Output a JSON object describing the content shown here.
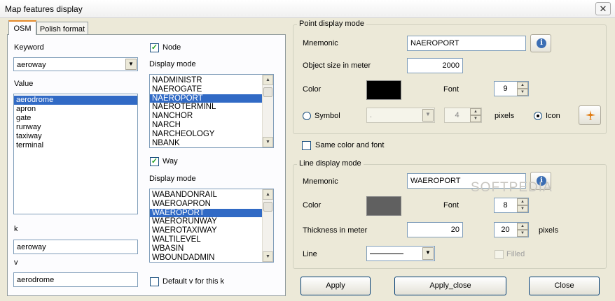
{
  "window": {
    "title": "Map features display",
    "close_glyph": "✕"
  },
  "tabs": [
    {
      "label": "OSM"
    },
    {
      "label": "Polish format"
    }
  ],
  "osm": {
    "keyword_label": "Keyword",
    "keyword_value": "aeroway",
    "value_label": "Value",
    "values": [
      "aerodrome",
      "apron",
      "gate",
      "runway",
      "taxiway",
      "terminal"
    ],
    "selected_value": "aerodrome",
    "k_label": "k",
    "k_value": "aeroway",
    "v_label": "v",
    "v_value": "aerodrome"
  },
  "polish": {
    "node_label": "Node",
    "node_display_mode_label": "Display mode",
    "node_modes": [
      "NADMINISTR",
      "NAEROGATE",
      "NAEROPORT",
      "NAEROTERMINL",
      "NANCHOR",
      "NARCH",
      "NARCHEOLOGY",
      "NBANK"
    ],
    "node_selected": "NAEROPORT",
    "way_label": "Way",
    "way_display_mode_label": "Display mode",
    "way_modes": [
      "WABANDONRAIL",
      "WAEROAPRON",
      "WAEROPORT",
      "WAERORUNWAY",
      "WAEROTAXIWAY",
      "WALTILEVEL",
      "WBASIN",
      "WBOUNDADMIN"
    ],
    "way_selected": "WAEROPORT",
    "default_v_label": "Default v for this k"
  },
  "point_display": {
    "legend": "Point display mode",
    "mnemonic_label": "Mnemonic",
    "mnemonic_value": "NAEROPORT",
    "object_size_label": "Object size in meter",
    "object_size_value": "2000",
    "color_label": "Color",
    "color_value": "#000000",
    "font_label": "Font",
    "font_value": "9",
    "symbol_label": "Symbol",
    "symbol_value": ".",
    "symbol_size_value": "4",
    "pixels_label": "pixels",
    "icon_label": "Icon"
  },
  "same_color_label": "Same color and font",
  "line_display": {
    "legend": "Line display mode",
    "mnemonic_label": "Mnemonic",
    "mnemonic_value": "WAEROPORT",
    "color_label": "Color",
    "color_value": "#606060",
    "font_label": "Font",
    "font_value": "8",
    "thickness_label": "Thickness in meter",
    "thickness_value": "20",
    "thickness_pixels_value": "20",
    "pixels_label": "pixels",
    "line_label": "Line",
    "filled_label": "Filled"
  },
  "buttons": {
    "apply": "Apply",
    "apply_close": "Apply_close",
    "close": "Close"
  },
  "watermark": "SOFTPEDIA"
}
